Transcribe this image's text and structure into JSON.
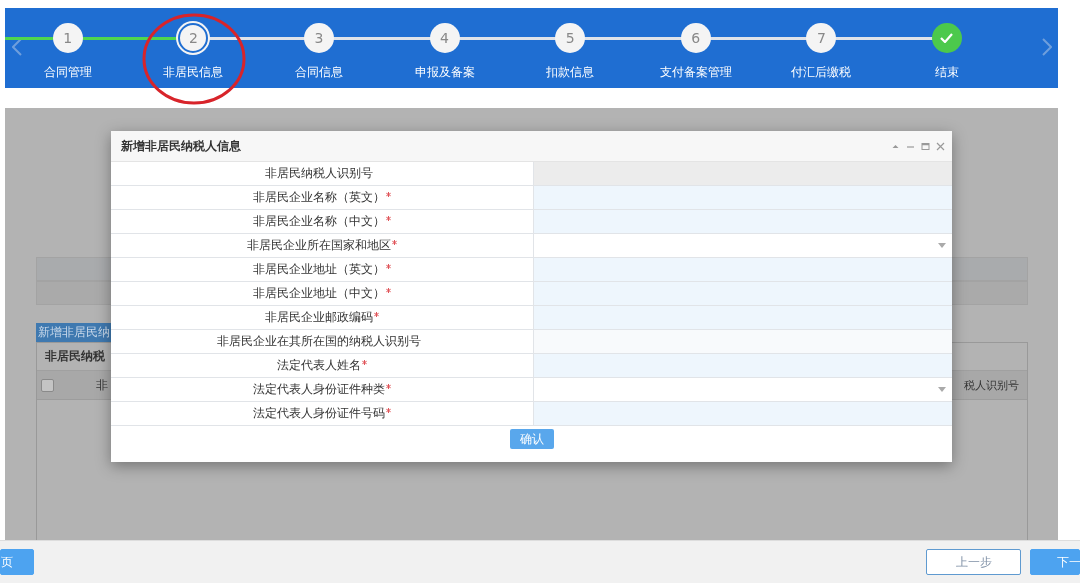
{
  "steps": [
    {
      "kind": "number",
      "number": "1",
      "label": "合同管理",
      "completed": true,
      "current": false,
      "highlighted": false
    },
    {
      "kind": "number",
      "number": "2",
      "label": "非居民信息",
      "completed": false,
      "current": true,
      "highlighted": true
    },
    {
      "kind": "number",
      "number": "3",
      "label": "合同信息",
      "completed": false,
      "current": false,
      "highlighted": false
    },
    {
      "kind": "number",
      "number": "4",
      "label": "申报及备案",
      "completed": false,
      "current": false,
      "highlighted": false
    },
    {
      "kind": "number",
      "number": "5",
      "label": "扣款信息",
      "completed": false,
      "current": false,
      "highlighted": false
    },
    {
      "kind": "number",
      "number": "6",
      "label": "支付备案管理",
      "completed": false,
      "current": false,
      "highlighted": false
    },
    {
      "kind": "number",
      "number": "7",
      "label": "付汇后缴税",
      "completed": false,
      "current": false,
      "highlighted": false
    },
    {
      "kind": "finish",
      "label": "结束",
      "completed": false,
      "current": false,
      "highlighted": false
    }
  ],
  "background": {
    "section_title": "新增非居民纳",
    "table_header": "非居民纳税",
    "row": {
      "checked": false,
      "cell_1": "非",
      "cell_2": "税人识别号"
    }
  },
  "dialog": {
    "title": "新增非居民纳税人信息",
    "fields": [
      {
        "label": "非居民纳税人识别号",
        "required": false,
        "kind": "readonly"
      },
      {
        "label": "非居民企业名称（英文）",
        "required": true,
        "kind": "text"
      },
      {
        "label": "非居民企业名称（中文）",
        "required": true,
        "kind": "text"
      },
      {
        "label": "非居民企业所在国家和地区",
        "required": true,
        "kind": "select"
      },
      {
        "label": "非居民企业地址（英文）",
        "required": true,
        "kind": "text"
      },
      {
        "label": "非居民企业地址（中文）",
        "required": true,
        "kind": "text"
      },
      {
        "label": "非居民企业邮政编码",
        "required": true,
        "kind": "text"
      },
      {
        "label": "非居民企业在其所在国的纳税人识别号",
        "required": false,
        "kind": "text"
      },
      {
        "label": "法定代表人姓名",
        "required": true,
        "kind": "text"
      },
      {
        "label": "法定代表人身份证件种类",
        "required": true,
        "kind": "select"
      },
      {
        "label": "法定代表人身份证件号码",
        "required": true,
        "kind": "text"
      }
    ],
    "confirm_button": "确认"
  },
  "footer": {
    "buttons": [
      {
        "label": "页",
        "kind": "primary"
      },
      {
        "label": "上一步",
        "kind": "outline"
      },
      {
        "label": "下一",
        "kind": "primary"
      }
    ]
  }
}
